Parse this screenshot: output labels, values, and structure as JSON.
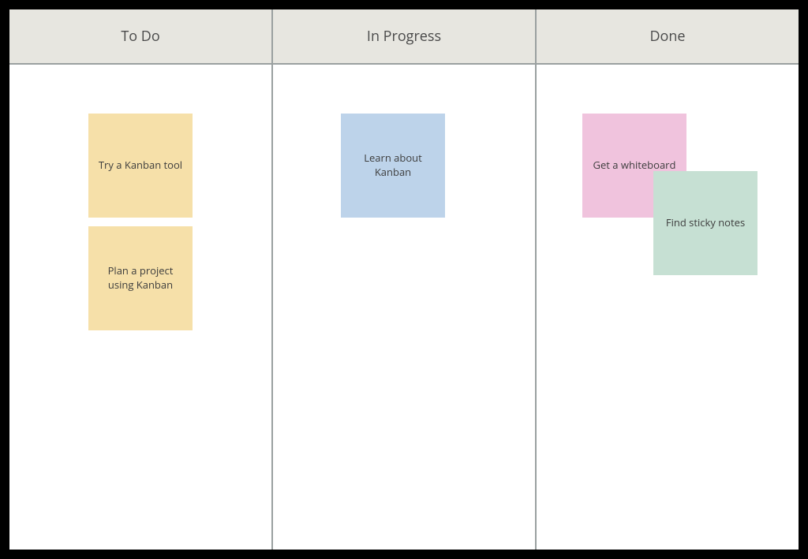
{
  "columns": [
    {
      "title": "To Do"
    },
    {
      "title": "In Progress"
    },
    {
      "title": "Done"
    }
  ],
  "cards": {
    "todo1": "Try a Kanban tool",
    "todo2": "Plan a project using Kanban",
    "prog1": "Learn about Kanban",
    "done1": "Get a whiteboard",
    "done2": "Find sticky notes"
  }
}
